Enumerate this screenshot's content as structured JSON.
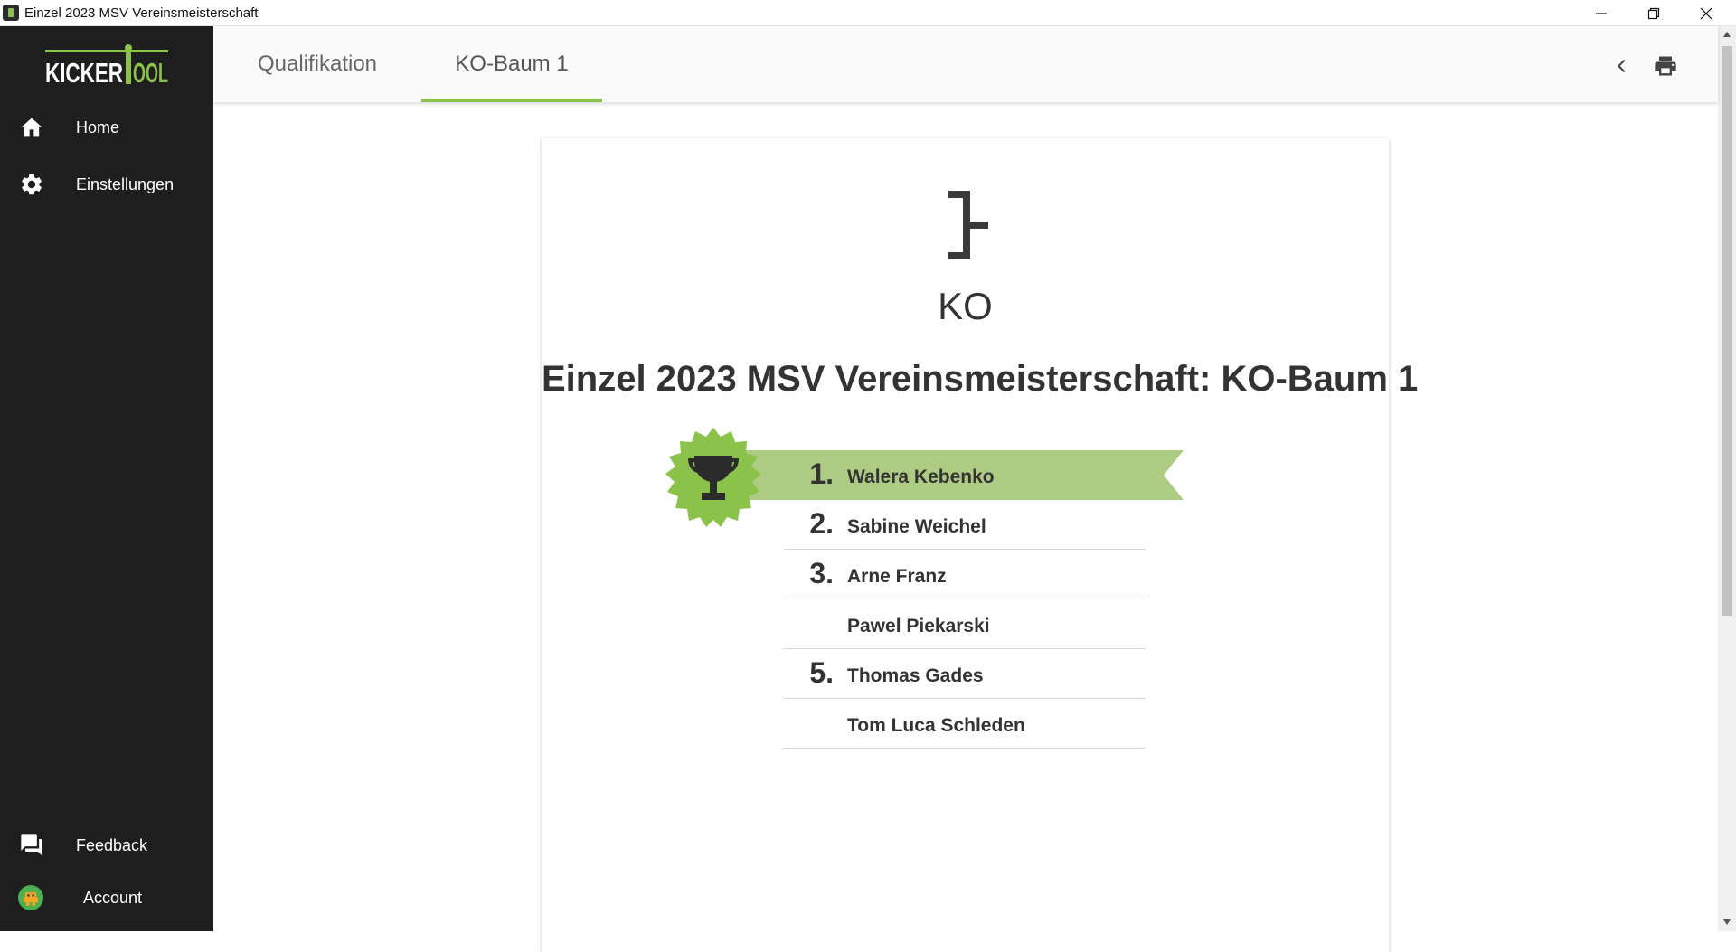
{
  "window": {
    "title": "Einzel 2023 MSV Vereinsmeisterschaft"
  },
  "brand": {
    "logo_part1": "KICKER",
    "logo_part2": "TOOL",
    "accent_color": "#8bc34a",
    "sidebar_bg": "#1e1e1e"
  },
  "sidebar": {
    "items": [
      {
        "label": "Home",
        "icon": "home-icon"
      },
      {
        "label": "Einstellungen",
        "icon": "gear-icon"
      }
    ],
    "bottom_items": [
      {
        "label": "Feedback",
        "icon": "feedback-icon"
      },
      {
        "label": "Account",
        "icon": "avatar"
      }
    ]
  },
  "tabs": [
    {
      "label": "Qualifikation",
      "active": false
    },
    {
      "label": "KO-Baum 1",
      "active": true
    }
  ],
  "toolbar": {
    "back_icon": "chevron-left-icon",
    "print_icon": "print-icon"
  },
  "card": {
    "mode_label": "KO",
    "title": "Einzel 2023 MSV Vereinsmeisterschaft: KO-Baum 1",
    "ranking": [
      {
        "rank": "1.",
        "name": "Walera Kebenko"
      },
      {
        "rank": "2.",
        "name": "Sabine Weichel"
      },
      {
        "rank": "3.",
        "name": "Arne Franz"
      },
      {
        "rank": "",
        "name": "Pawel Piekarski"
      },
      {
        "rank": "5.",
        "name": "Thomas Gades"
      },
      {
        "rank": "",
        "name": "Tom Luca Schleden"
      }
    ]
  }
}
